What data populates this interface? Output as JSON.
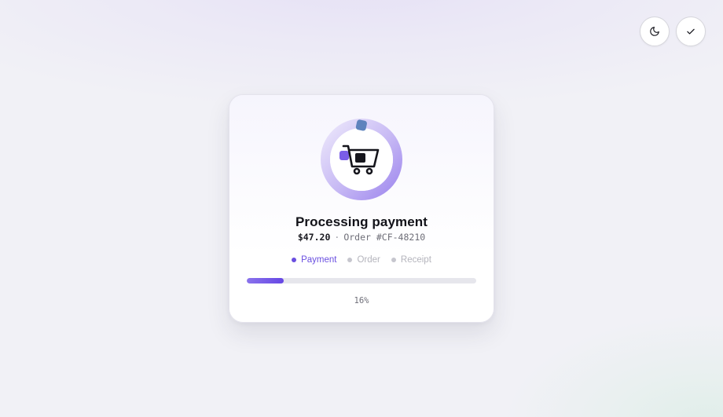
{
  "header": {
    "theme_toggle_icon": "moon-icon",
    "confirm_icon": "check-icon"
  },
  "card": {
    "icon": "shopping-cart-icon",
    "title": "Processing payment",
    "amount": "$47.20",
    "separator": "·",
    "order_label": "Order #CF-48210",
    "steps": [
      {
        "label": "Payment",
        "state": "active"
      },
      {
        "label": "Order",
        "state": "pending"
      },
      {
        "label": "Receipt",
        "state": "pending"
      }
    ],
    "progress": 16,
    "progress_text": "16%"
  },
  "colors": {
    "accent": "#6a4fe0",
    "ring": "#a995f0",
    "track": "#e6e6ec",
    "ink": "#121218"
  }
}
